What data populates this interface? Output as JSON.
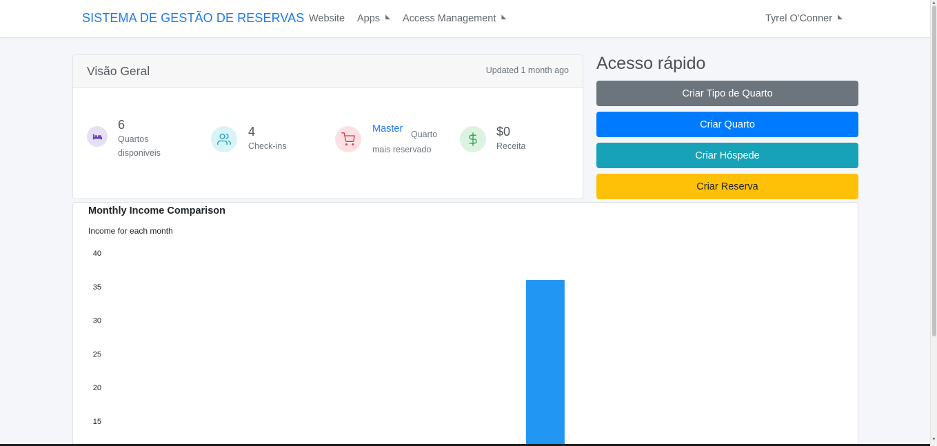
{
  "navbar": {
    "brand": "SISTEMA DE GESTÃO DE RESERVAS",
    "links": [
      "Website",
      "Apps",
      "Access Management"
    ],
    "user_name": "Tyrel O'Conner"
  },
  "overview": {
    "title": "Visão Geral",
    "updated": "Updated 1 month ago",
    "stats": [
      {
        "value": "6",
        "label_line1": "Quartos",
        "label_line2": "disponiveis",
        "icon": "bed-icon",
        "color": "#6f42c1"
      },
      {
        "value": "4",
        "label_line1": "Check-ins",
        "icon": "users-icon",
        "color": "#17a2b8"
      },
      {
        "value": "Master",
        "label_inline": "Quarto",
        "label_line2": "mais reservado",
        "icon": "cart-icon",
        "color": "#dc3545"
      },
      {
        "value": "$0",
        "label_line1": "Receita",
        "icon": "dollar-icon",
        "color": "#28a745"
      }
    ]
  },
  "quick_access": {
    "title": "Acesso rápido",
    "buttons": [
      {
        "label": "Criar Tipo de Quarto",
        "color": "#6c757d"
      },
      {
        "label": "Criar Quarto",
        "color": "#007bff"
      },
      {
        "label": "Criar Hóspede",
        "color": "#17a2b8"
      },
      {
        "label": "Criar Reserva",
        "color": "#ffc107"
      }
    ]
  },
  "chart_data": {
    "type": "bar",
    "title": "Monthly Income Comparison",
    "subtitle": "Income for each month",
    "xlabel": "",
    "ylabel": "",
    "y_ticks": [
      15,
      20,
      25,
      30,
      35,
      40
    ],
    "ylim": [
      15,
      40
    ],
    "grid": false,
    "bar_color": "#2196f3",
    "bars": [
      {
        "x_index": 6,
        "value": 36
      }
    ],
    "x_count": 12
  }
}
